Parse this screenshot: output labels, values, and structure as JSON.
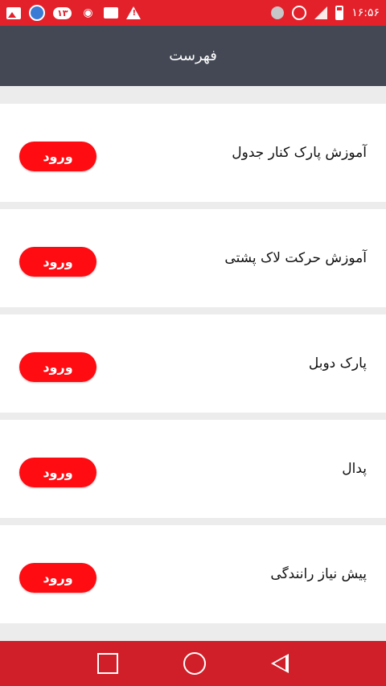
{
  "status_bar": {
    "notification_badge": "۱۳",
    "time": "۱۶:۵۶",
    "left_icons": [
      "image-icon",
      "sync-icon",
      "badge-icon",
      "wifi-hotspot-icon",
      "message-icon",
      "warning-icon"
    ],
    "right_icons": [
      "bluetooth-icon",
      "alarm-icon",
      "signal-icon",
      "battery-icon"
    ]
  },
  "appbar": {
    "title": "فهرست"
  },
  "items": [
    {
      "title": "آموزش پارک کنار جدول",
      "button": "ورود"
    },
    {
      "title": "آموزش حرکت لاک پشتی",
      "button": "ورود"
    },
    {
      "title": "پارک دوبل",
      "button": "ورود"
    },
    {
      "title": "پدال",
      "button": "ورود"
    },
    {
      "title": "پیش نیاز رانندگی",
      "button": "ورود"
    }
  ],
  "colors": {
    "status_bar": "#e3212b",
    "appbar": "#434854",
    "button": "#ff0b12",
    "navbar": "#d01f28"
  }
}
